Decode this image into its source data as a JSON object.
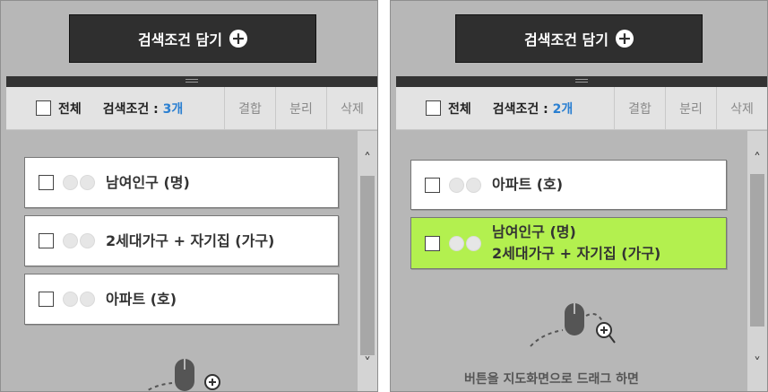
{
  "left_panel": {
    "add_button": "검색조건 담기",
    "toolbar": {
      "all_label": "전체",
      "cond_prefix": "검색조건 : ",
      "cond_count": "3개",
      "buttons": [
        "결합",
        "분리",
        "삭제"
      ]
    },
    "items": [
      {
        "label": "남여인구 (명)"
      },
      {
        "label": "2세대가구 + 자기집 (가구)"
      },
      {
        "label": "아파트 (호)"
      }
    ]
  },
  "right_panel": {
    "add_button": "검색조건 담기",
    "toolbar": {
      "all_label": "전체",
      "cond_prefix": "검색조건 : ",
      "cond_count": "2개",
      "buttons": [
        "결합",
        "분리",
        "삭제"
      ]
    },
    "items": [
      {
        "label": "아파트 (호)"
      },
      {
        "label_line1": "남여인구 (명)",
        "label_line2": "2세대가구 + 자기집 (가구)"
      }
    ],
    "drag_hint": "버튼을 지도화면으로 드래그 하면"
  },
  "colors": {
    "accent_count": "#2a7fd1",
    "combined_item": "#b3f04f",
    "button_dark": "#2f2f2f"
  },
  "icons": [
    "plus-circle-icon",
    "checkbox-icon",
    "chevron-up-icon",
    "chevron-down-icon",
    "mouse-icon",
    "zoom-in-icon"
  ]
}
